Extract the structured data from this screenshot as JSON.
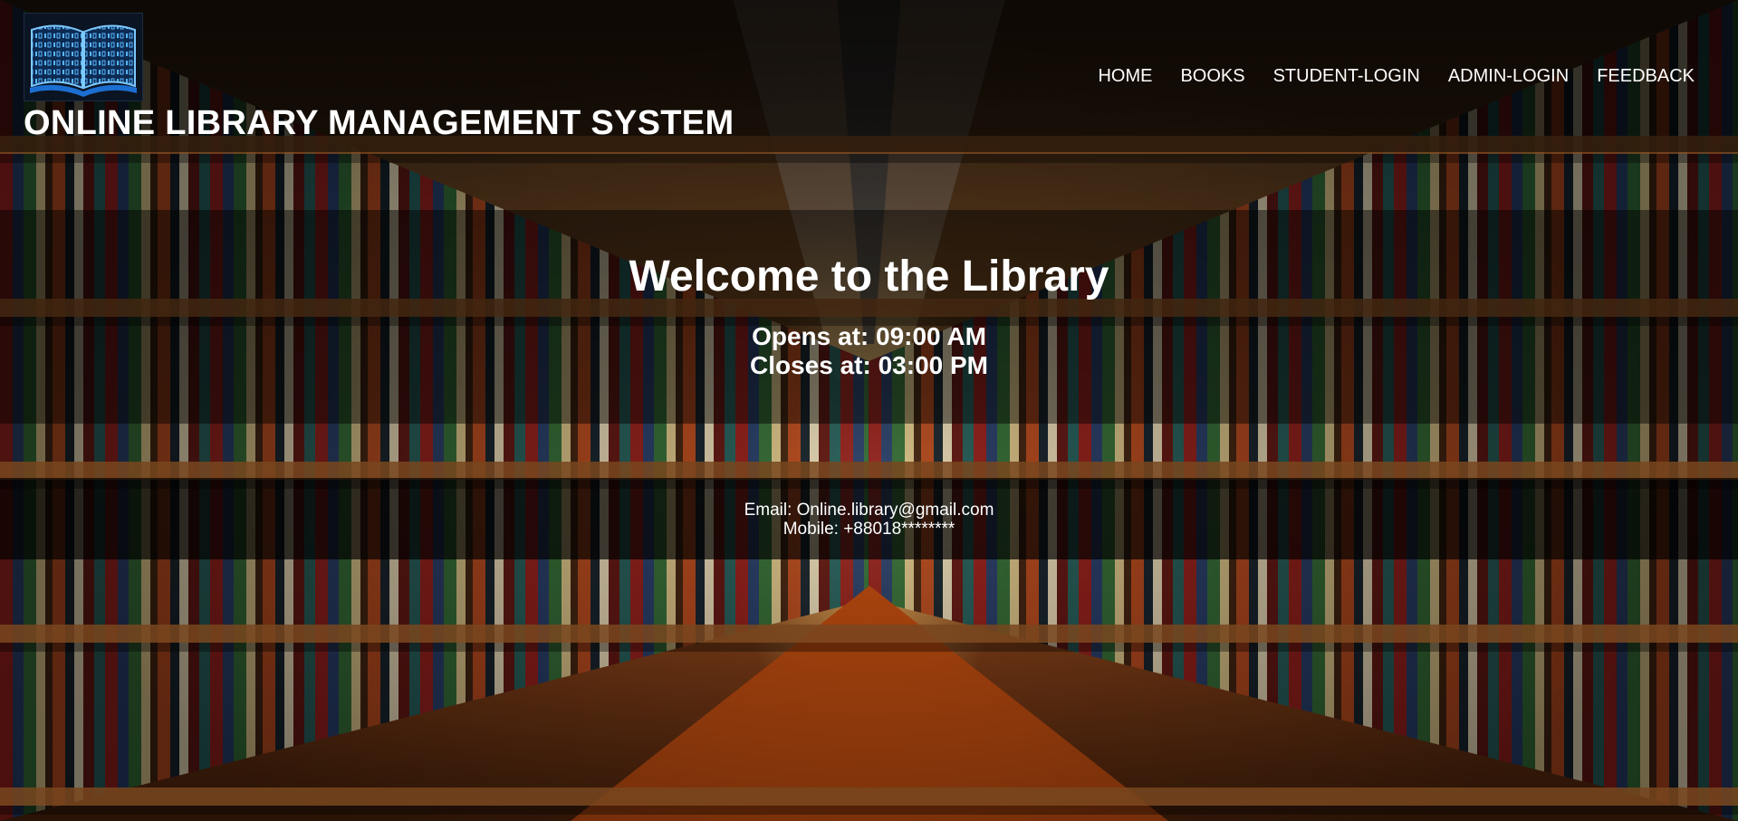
{
  "header": {
    "logo_icon": "open-book-binary-icon",
    "title": "ONLINE LIBRARY MANAGEMENT SYSTEM"
  },
  "nav": {
    "items": [
      {
        "label": "HOME"
      },
      {
        "label": "BOOKS"
      },
      {
        "label": "STUDENT-LOGIN"
      },
      {
        "label": "ADMIN-LOGIN"
      },
      {
        "label": "FEEDBACK"
      }
    ]
  },
  "welcome": {
    "title": "Welcome to the Library",
    "opens": "Opens at: 09:00 AM",
    "closes": "Closes at: 03:00 PM"
  },
  "contact": {
    "email": "Email: Online.library@gmail.com",
    "mobile": "Mobile: +88018********"
  },
  "colors": {
    "text": "#ffffff",
    "logo_blue": "#2f8fe8",
    "overlay": "#000000"
  }
}
